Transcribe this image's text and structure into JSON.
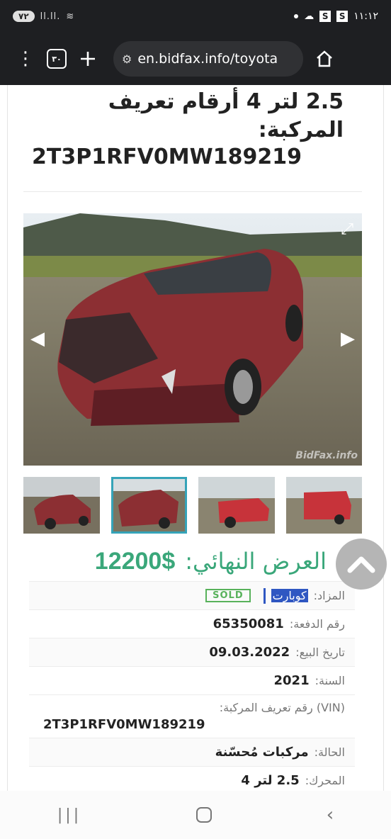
{
  "status_bar": {
    "battery": "٧٢",
    "time": "١١:١٢",
    "icons": [
      "signal-icon",
      "wifi-icon",
      "dot-icon",
      "cloud-icon",
      "s-app-icon",
      "s-app-icon"
    ],
    "s1": "S",
    "s2": "S"
  },
  "browser": {
    "tab_count": "٣٠",
    "url": "en.bidfax.info/toyota",
    "menu_icon": "more-vert-icon",
    "new_tab_icon": "plus-icon",
    "home_icon": "home-icon"
  },
  "listing": {
    "title_line": "2.5 لتر 4 أرقام تعريف المركبة:",
    "title_vin": "2T3P1RFV0MW189219",
    "watermark": "BidFax.info",
    "price_label": "العرض النهائي:",
    "price_value": "12200$",
    "auction_label": "المزاد:",
    "auction_value": "كوبارت",
    "sold_badge": "SOLD",
    "rows": [
      {
        "label": "رقم الدفعة:",
        "value": "65350081"
      },
      {
        "label": "تاريخ البيع:",
        "value": "09.03.2022"
      },
      {
        "label": "السنة:",
        "value": "2021"
      }
    ],
    "vin_label": "(VIN) رقم تعريف المركبة:",
    "vin_value": "2T3P1RFV0MW189219",
    "rows2": [
      {
        "label": "الحالة:",
        "value": "مركبات مُحسّنة"
      },
      {
        "label": "المحرك:",
        "value": "2.5 لتر 4"
      }
    ]
  },
  "colors": {
    "price_green": "#3aa77a",
    "sold_green": "#58b25b",
    "thumb_active": "#35a3b8",
    "selection_blue": "#2f57c2"
  }
}
